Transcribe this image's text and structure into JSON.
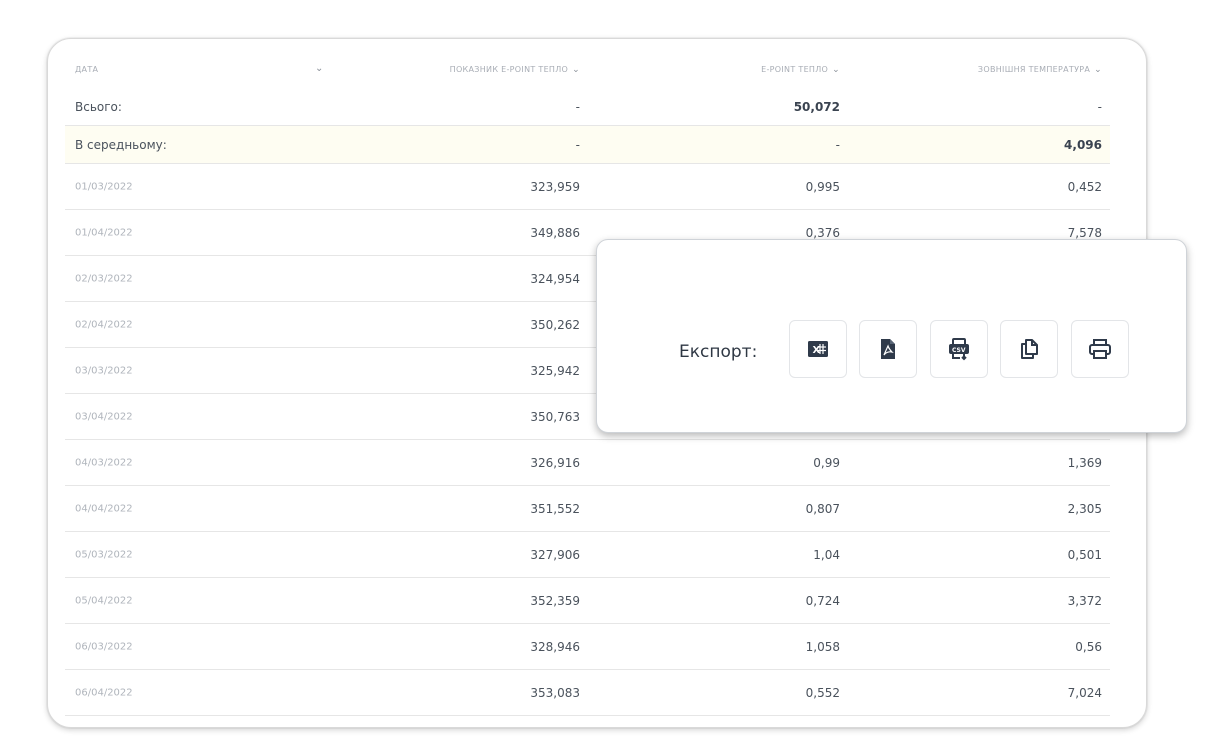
{
  "table": {
    "headers": [
      "ДАТА",
      "ПОКАЗНИК E-POINT ТЕПЛО",
      "E-POINT ТЕПЛО",
      "ЗОВНІШНЯ ТЕМПЕРАТУРА"
    ],
    "total": {
      "label": "Всього:",
      "v1": "-",
      "v2": "50,072",
      "v3": "-"
    },
    "average": {
      "label": "В середньому:",
      "v1": "-",
      "v2": "-",
      "v3": "4,096"
    },
    "rows": [
      {
        "date": "01/03/2022",
        "v1": "323,959",
        "v2": "0,995",
        "v3": "0,452"
      },
      {
        "date": "01/04/2022",
        "v1": "349,886",
        "v2": "0,376",
        "v3": "7,578"
      },
      {
        "date": "02/03/2022",
        "v1": "324,954",
        "v2": "",
        "v3": ""
      },
      {
        "date": "02/04/2022",
        "v1": "350,262",
        "v2": "",
        "v3": ""
      },
      {
        "date": "03/03/2022",
        "v1": "325,942",
        "v2": "",
        "v3": ""
      },
      {
        "date": "03/04/2022",
        "v1": "350,763",
        "v2": "",
        "v3": ""
      },
      {
        "date": "04/03/2022",
        "v1": "326,916",
        "v2": "0,99",
        "v3": "1,369"
      },
      {
        "date": "04/04/2022",
        "v1": "351,552",
        "v2": "0,807",
        "v3": "2,305"
      },
      {
        "date": "05/03/2022",
        "v1": "327,906",
        "v2": "1,04",
        "v3": "0,501"
      },
      {
        "date": "05/04/2022",
        "v1": "352,359",
        "v2": "0,724",
        "v3": "3,372"
      },
      {
        "date": "06/03/2022",
        "v1": "328,946",
        "v2": "1,058",
        "v3": "0,56"
      },
      {
        "date": "06/04/2022",
        "v1": "353,083",
        "v2": "0,552",
        "v3": "7,024"
      }
    ]
  },
  "export": {
    "label": "Експорт:",
    "buttons": [
      "excel-icon",
      "pdf-icon",
      "csv-icon",
      "copy-icon",
      "print-icon"
    ]
  }
}
